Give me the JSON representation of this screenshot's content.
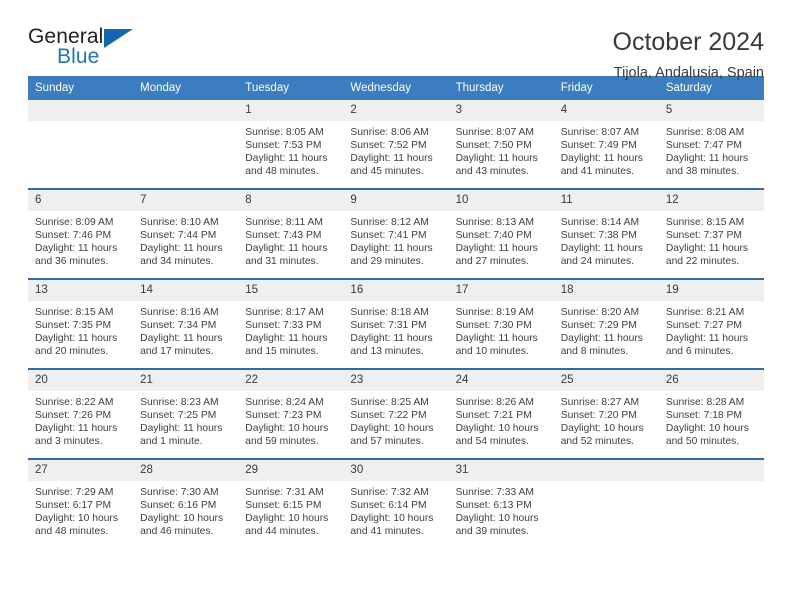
{
  "brand": {
    "name_part1": "General",
    "name_part2": "Blue",
    "flag_icon": "triangle-flag-icon"
  },
  "header": {
    "title": "October 2024",
    "subtitle": "Tijola, Andalusia, Spain"
  },
  "colors": {
    "header_blue": "#3b7dbf",
    "row_border_blue": "#2e6da4",
    "daynum_strip": "#efefef",
    "brand_blue": "#1f74bd",
    "text": "#3a3a3a"
  },
  "weekday_headers": [
    "Sunday",
    "Monday",
    "Tuesday",
    "Wednesday",
    "Thursday",
    "Friday",
    "Saturday"
  ],
  "labels": {
    "sunrise": "Sunrise:",
    "sunset": "Sunset:",
    "daylight": "Daylight:"
  },
  "weeks": [
    [
      {
        "day": "",
        "sunrise": "",
        "sunset": "",
        "daylight": ""
      },
      {
        "day": "",
        "sunrise": "",
        "sunset": "",
        "daylight": ""
      },
      {
        "day": "1",
        "sunrise": "Sunrise: 8:05 AM",
        "sunset": "Sunset: 7:53 PM",
        "daylight": "Daylight: 11 hours and 48 minutes."
      },
      {
        "day": "2",
        "sunrise": "Sunrise: 8:06 AM",
        "sunset": "Sunset: 7:52 PM",
        "daylight": "Daylight: 11 hours and 45 minutes."
      },
      {
        "day": "3",
        "sunrise": "Sunrise: 8:07 AM",
        "sunset": "Sunset: 7:50 PM",
        "daylight": "Daylight: 11 hours and 43 minutes."
      },
      {
        "day": "4",
        "sunrise": "Sunrise: 8:07 AM",
        "sunset": "Sunset: 7:49 PM",
        "daylight": "Daylight: 11 hours and 41 minutes."
      },
      {
        "day": "5",
        "sunrise": "Sunrise: 8:08 AM",
        "sunset": "Sunset: 7:47 PM",
        "daylight": "Daylight: 11 hours and 38 minutes."
      }
    ],
    [
      {
        "day": "6",
        "sunrise": "Sunrise: 8:09 AM",
        "sunset": "Sunset: 7:46 PM",
        "daylight": "Daylight: 11 hours and 36 minutes."
      },
      {
        "day": "7",
        "sunrise": "Sunrise: 8:10 AM",
        "sunset": "Sunset: 7:44 PM",
        "daylight": "Daylight: 11 hours and 34 minutes."
      },
      {
        "day": "8",
        "sunrise": "Sunrise: 8:11 AM",
        "sunset": "Sunset: 7:43 PM",
        "daylight": "Daylight: 11 hours and 31 minutes."
      },
      {
        "day": "9",
        "sunrise": "Sunrise: 8:12 AM",
        "sunset": "Sunset: 7:41 PM",
        "daylight": "Daylight: 11 hours and 29 minutes."
      },
      {
        "day": "10",
        "sunrise": "Sunrise: 8:13 AM",
        "sunset": "Sunset: 7:40 PM",
        "daylight": "Daylight: 11 hours and 27 minutes."
      },
      {
        "day": "11",
        "sunrise": "Sunrise: 8:14 AM",
        "sunset": "Sunset: 7:38 PM",
        "daylight": "Daylight: 11 hours and 24 minutes."
      },
      {
        "day": "12",
        "sunrise": "Sunrise: 8:15 AM",
        "sunset": "Sunset: 7:37 PM",
        "daylight": "Daylight: 11 hours and 22 minutes."
      }
    ],
    [
      {
        "day": "13",
        "sunrise": "Sunrise: 8:15 AM",
        "sunset": "Sunset: 7:35 PM",
        "daylight": "Daylight: 11 hours and 20 minutes."
      },
      {
        "day": "14",
        "sunrise": "Sunrise: 8:16 AM",
        "sunset": "Sunset: 7:34 PM",
        "daylight": "Daylight: 11 hours and 17 minutes."
      },
      {
        "day": "15",
        "sunrise": "Sunrise: 8:17 AM",
        "sunset": "Sunset: 7:33 PM",
        "daylight": "Daylight: 11 hours and 15 minutes."
      },
      {
        "day": "16",
        "sunrise": "Sunrise: 8:18 AM",
        "sunset": "Sunset: 7:31 PM",
        "daylight": "Daylight: 11 hours and 13 minutes."
      },
      {
        "day": "17",
        "sunrise": "Sunrise: 8:19 AM",
        "sunset": "Sunset: 7:30 PM",
        "daylight": "Daylight: 11 hours and 10 minutes."
      },
      {
        "day": "18",
        "sunrise": "Sunrise: 8:20 AM",
        "sunset": "Sunset: 7:29 PM",
        "daylight": "Daylight: 11 hours and 8 minutes."
      },
      {
        "day": "19",
        "sunrise": "Sunrise: 8:21 AM",
        "sunset": "Sunset: 7:27 PM",
        "daylight": "Daylight: 11 hours and 6 minutes."
      }
    ],
    [
      {
        "day": "20",
        "sunrise": "Sunrise: 8:22 AM",
        "sunset": "Sunset: 7:26 PM",
        "daylight": "Daylight: 11 hours and 3 minutes."
      },
      {
        "day": "21",
        "sunrise": "Sunrise: 8:23 AM",
        "sunset": "Sunset: 7:25 PM",
        "daylight": "Daylight: 11 hours and 1 minute."
      },
      {
        "day": "22",
        "sunrise": "Sunrise: 8:24 AM",
        "sunset": "Sunset: 7:23 PM",
        "daylight": "Daylight: 10 hours and 59 minutes."
      },
      {
        "day": "23",
        "sunrise": "Sunrise: 8:25 AM",
        "sunset": "Sunset: 7:22 PM",
        "daylight": "Daylight: 10 hours and 57 minutes."
      },
      {
        "day": "24",
        "sunrise": "Sunrise: 8:26 AM",
        "sunset": "Sunset: 7:21 PM",
        "daylight": "Daylight: 10 hours and 54 minutes."
      },
      {
        "day": "25",
        "sunrise": "Sunrise: 8:27 AM",
        "sunset": "Sunset: 7:20 PM",
        "daylight": "Daylight: 10 hours and 52 minutes."
      },
      {
        "day": "26",
        "sunrise": "Sunrise: 8:28 AM",
        "sunset": "Sunset: 7:18 PM",
        "daylight": "Daylight: 10 hours and 50 minutes."
      }
    ],
    [
      {
        "day": "27",
        "sunrise": "Sunrise: 7:29 AM",
        "sunset": "Sunset: 6:17 PM",
        "daylight": "Daylight: 10 hours and 48 minutes."
      },
      {
        "day": "28",
        "sunrise": "Sunrise: 7:30 AM",
        "sunset": "Sunset: 6:16 PM",
        "daylight": "Daylight: 10 hours and 46 minutes."
      },
      {
        "day": "29",
        "sunrise": "Sunrise: 7:31 AM",
        "sunset": "Sunset: 6:15 PM",
        "daylight": "Daylight: 10 hours and 44 minutes."
      },
      {
        "day": "30",
        "sunrise": "Sunrise: 7:32 AM",
        "sunset": "Sunset: 6:14 PM",
        "daylight": "Daylight: 10 hours and 41 minutes."
      },
      {
        "day": "31",
        "sunrise": "Sunrise: 7:33 AM",
        "sunset": "Sunset: 6:13 PM",
        "daylight": "Daylight: 10 hours and 39 minutes."
      },
      {
        "day": "",
        "sunrise": "",
        "sunset": "",
        "daylight": ""
      },
      {
        "day": "",
        "sunrise": "",
        "sunset": "",
        "daylight": ""
      }
    ]
  ]
}
